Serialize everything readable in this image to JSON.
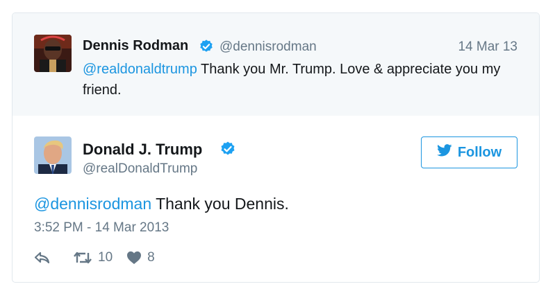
{
  "parent_tweet": {
    "name": "Dennis Rodman",
    "handle": "@dennisrodman",
    "date": "14 Mar 13",
    "mention": "@realdonaldtrump",
    "text": " Thank you Mr. Trump. Love & appreciate you my friend."
  },
  "main_tweet": {
    "name": "Donald J. Trump",
    "handle": "@realDonaldTrump",
    "follow_label": "Follow",
    "mention": "@dennisrodman",
    "text": " Thank you Dennis.",
    "timestamp": "3:52 PM - 14 Mar 2013",
    "retweets": "10",
    "likes": "8"
  },
  "colors": {
    "accent": "#1b95e0",
    "verified": "#1da1f2",
    "secondary_text": "#657786",
    "parent_bg": "#f5f8fa"
  },
  "icons": [
    "verified-icon",
    "twitter-bird-icon",
    "reply-icon",
    "retweet-icon",
    "heart-icon"
  ]
}
